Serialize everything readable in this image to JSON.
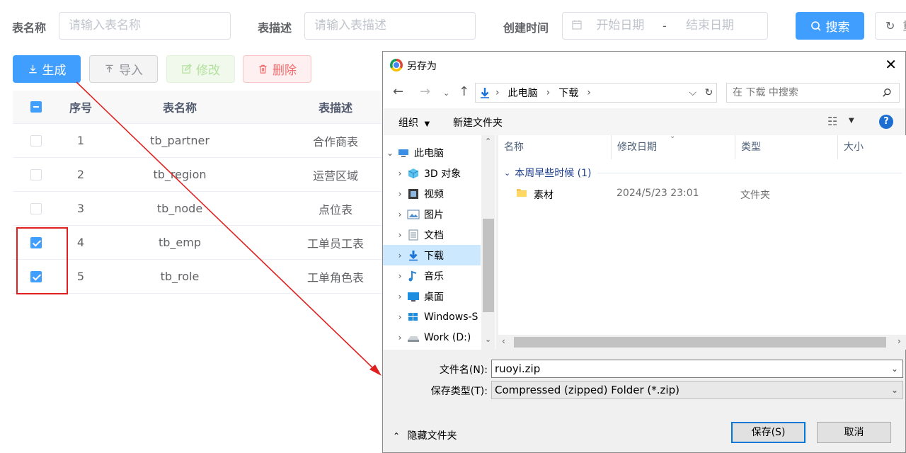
{
  "filters": {
    "table_name_label": "表名称",
    "table_name_placeholder": "请输入表名称",
    "table_desc_label": "表描述",
    "table_desc_placeholder": "请输入表描述",
    "create_time_label": "创建时间",
    "start_date_placeholder": "开始日期",
    "date_separator": "-",
    "end_date_placeholder": "结束日期",
    "search_label": "搜索",
    "reset_label": "重"
  },
  "actions": {
    "generate": "生成",
    "import": "导入",
    "edit": "修改",
    "delete": "删除"
  },
  "table": {
    "headers": [
      "序号",
      "表名称",
      "表描述"
    ],
    "rows": [
      {
        "index": "1",
        "name": "tb_partner",
        "desc": "合作商表",
        "checked": false
      },
      {
        "index": "2",
        "name": "tb_region",
        "desc": "运营区域",
        "checked": false
      },
      {
        "index": "3",
        "name": "tb_node",
        "desc": "点位表",
        "checked": false
      },
      {
        "index": "4",
        "name": "tb_emp",
        "desc": "工单员工表",
        "checked": true
      },
      {
        "index": "5",
        "name": "tb_role",
        "desc": "工单角色表",
        "checked": true
      }
    ]
  },
  "dialog": {
    "title": "另存为",
    "path": [
      "此电脑",
      "下载"
    ],
    "search_placeholder": "在 下载 中搜索",
    "organize": "组织",
    "new_folder": "新建文件夹",
    "tree": [
      {
        "label": "此电脑",
        "icon": "computer-icon"
      },
      {
        "label": "3D 对象",
        "icon": "cube-icon"
      },
      {
        "label": "视频",
        "icon": "video-icon"
      },
      {
        "label": "图片",
        "icon": "picture-icon"
      },
      {
        "label": "文档",
        "icon": "document-icon"
      },
      {
        "label": "下载",
        "icon": "download-icon"
      },
      {
        "label": "音乐",
        "icon": "music-icon"
      },
      {
        "label": "桌面",
        "icon": "desktop-icon"
      },
      {
        "label": "Windows-S",
        "icon": "drive-icon"
      },
      {
        "label": "Work (D:)",
        "icon": "drive-icon"
      }
    ],
    "columns": [
      "名称",
      "修改日期",
      "类型",
      "大小"
    ],
    "group_label": "本周早些时候 (1)",
    "files": [
      {
        "name": "素材",
        "modified": "2024/5/23 23:01",
        "type": "文件夹"
      }
    ],
    "filename_label": "文件名(N):",
    "filename_value": "ruoyi.zip",
    "filetype_label": "保存类型(T):",
    "filetype_value": "Compressed (zipped) Folder (*.zip)",
    "hide_folders": "隐藏文件夹",
    "save": "保存(S)",
    "cancel": "取消"
  },
  "colors": {
    "primary": "#409eff",
    "highlight_box": "#e02020",
    "arrow": "#e02020"
  }
}
